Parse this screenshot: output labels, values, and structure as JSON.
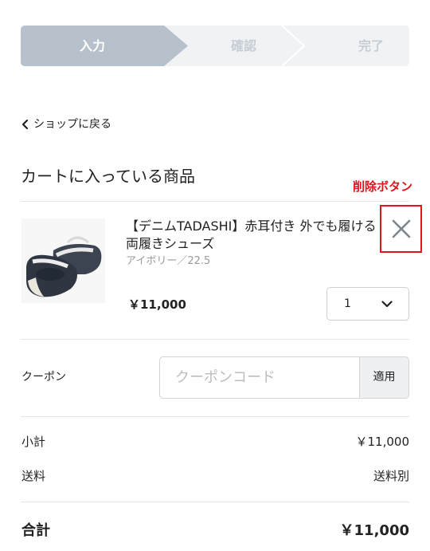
{
  "stepper": {
    "steps": [
      "入力",
      "確認",
      "完了"
    ],
    "active_index": 0
  },
  "back_link": {
    "label": "ショップに戻る"
  },
  "cart": {
    "title": "カートに入っている商品",
    "delete_annotation": "削除ボタン",
    "item": {
      "name": "【デニムTADASHI】赤耳付き 外でも履ける 両履きシューズ",
      "variant": "アイボリー／22.5",
      "price": "￥11,000",
      "quantity": "1",
      "image_icon": "shoes-product-photo"
    }
  },
  "coupon": {
    "label": "クーポン",
    "placeholder": "クーポンコード",
    "value": "",
    "apply_label": "適用"
  },
  "summary": {
    "subtotal_label": "小計",
    "subtotal_value": "￥11,000",
    "shipping_label": "送料",
    "shipping_value": "送料別",
    "total_label": "合計",
    "total_value": "￥11,000"
  },
  "colors": {
    "accent_red": "#e0151d",
    "step_active": "#b6c1cc",
    "step_inactive": "#f0f2f4"
  }
}
